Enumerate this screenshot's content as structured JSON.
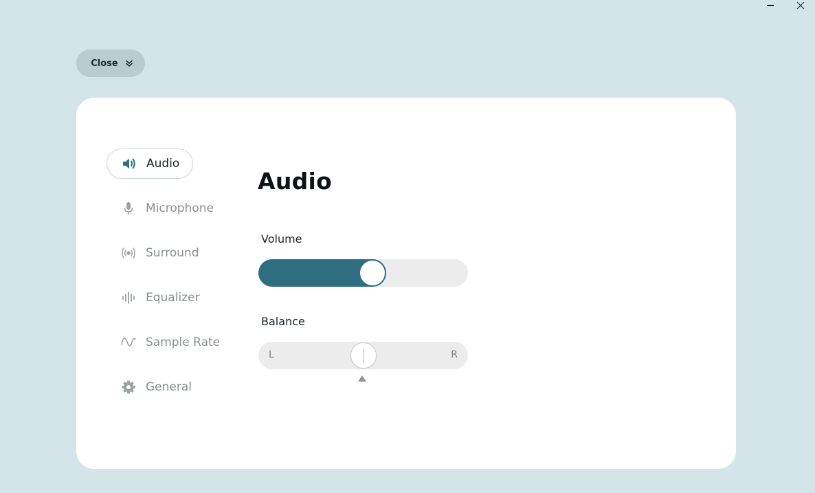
{
  "window": {
    "minimize_icon": "minimize-icon",
    "close_icon": "close-icon"
  },
  "close_pill": {
    "label": "Close",
    "icon": "double-chevron-down-icon"
  },
  "sidebar": {
    "items": [
      {
        "label": "Audio",
        "icon": "speaker-icon",
        "active": true
      },
      {
        "label": "Microphone",
        "icon": "microphone-icon",
        "active": false
      },
      {
        "label": "Surround",
        "icon": "surround-icon",
        "active": false
      },
      {
        "label": "Equalizer",
        "icon": "equalizer-icon",
        "active": false
      },
      {
        "label": "Sample Rate",
        "icon": "sine-wave-icon",
        "active": false
      },
      {
        "label": "General",
        "icon": "gear-icon",
        "active": false
      }
    ]
  },
  "main": {
    "title": "Audio",
    "volume": {
      "label": "Volume",
      "value": 0.55
    },
    "balance": {
      "label": "Balance",
      "left_label": "L",
      "right_label": "R",
      "value": 0.5
    }
  },
  "colors": {
    "background": "#d4e5e9",
    "accent": "#2e6e80",
    "track": "#ececec",
    "pill": "#b9cdd0"
  }
}
